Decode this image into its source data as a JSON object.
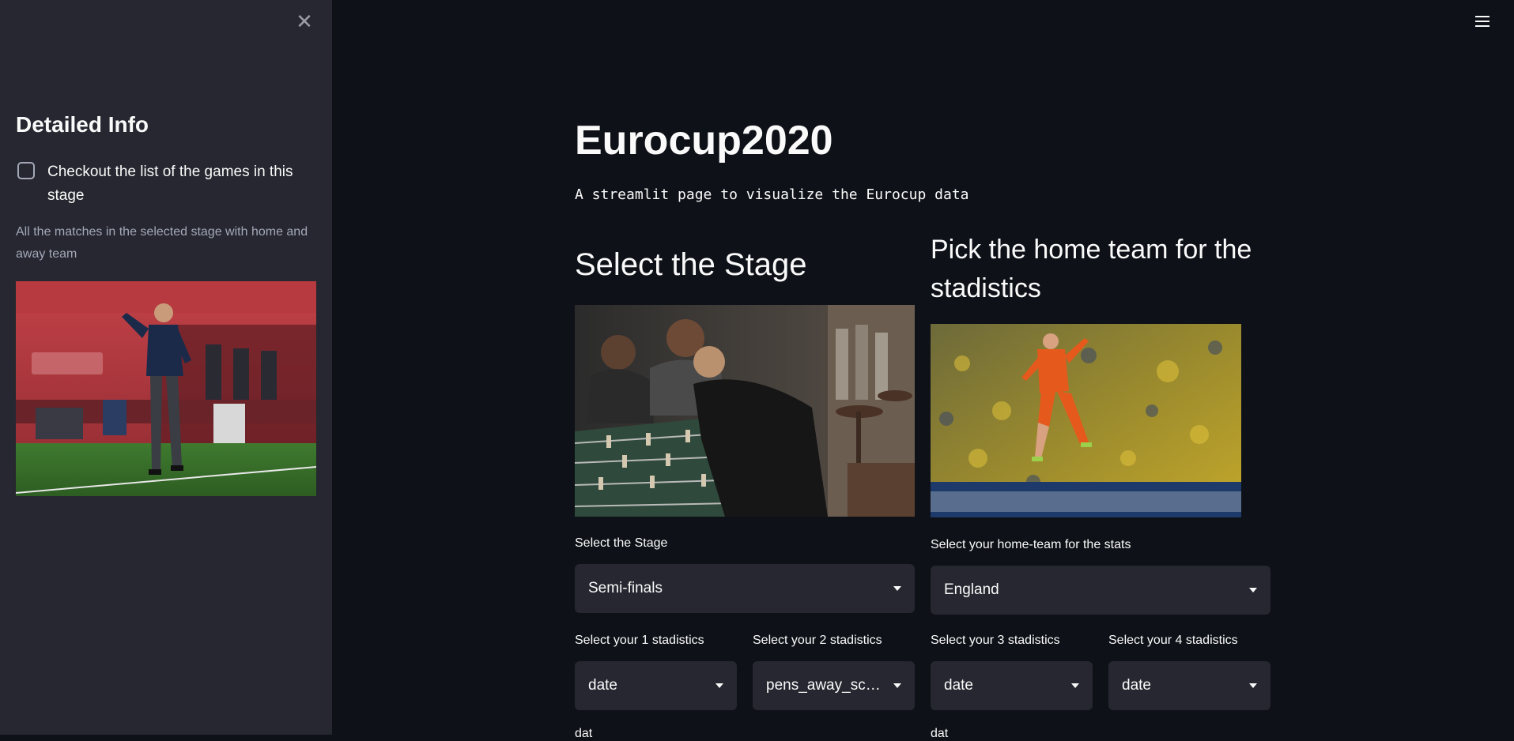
{
  "sidebar": {
    "title": "Detailed Info",
    "checkbox_label": "Checkout the list of the games in this stage",
    "caption": "All the matches in the selected stage with home and away team"
  },
  "main": {
    "title": "Eurocup2020",
    "subtitle": "A streamlit page to visualize the Eurocup data",
    "left": {
      "heading": "Select the Stage",
      "select_label": "Select the Stage",
      "select_value": "Semi-finals"
    },
    "right": {
      "heading": "Pick the home team for the stadistics",
      "select_label": "Select your home-team for the stats",
      "select_value": "England"
    },
    "stats": [
      {
        "label": "Select your 1 stadistics",
        "value": "date"
      },
      {
        "label": "Select your 2 stadistics",
        "value": "pens_away_score"
      },
      {
        "label": "Select your 3 stadistics",
        "value": "date"
      },
      {
        "label": "Select your 4 stadistics",
        "value": "date"
      }
    ],
    "cut_off": [
      "dat",
      "dat"
    ]
  },
  "icons": {
    "close": "close-icon",
    "menu": "hamburger-menu-icon",
    "dropdown": "chevron-down-icon"
  },
  "colors": {
    "background": "#0e1117",
    "sidebar": "#262730",
    "widget": "#262730",
    "text": "#fafafa",
    "muted": "#a3a8b8"
  }
}
